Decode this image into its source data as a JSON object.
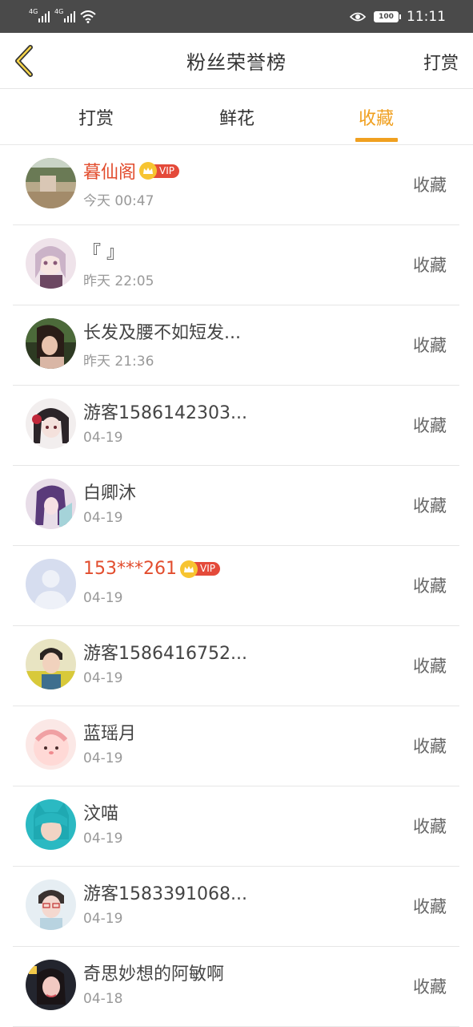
{
  "status_bar": {
    "signal1": "4G",
    "signal2": "4G",
    "battery": "100",
    "time": "11:11"
  },
  "nav": {
    "title": "粉丝荣誉榜",
    "action": "打赏"
  },
  "tabs": [
    {
      "label": "打赏"
    },
    {
      "label": "鲜花"
    },
    {
      "label": "收藏"
    }
  ],
  "active_tab": "收藏",
  "accent_color": "#f0a020",
  "vip_color": "#e24d2e",
  "vip_label": "VIP",
  "rows": [
    {
      "name": "暮仙阁",
      "vip": true,
      "time": "今天 00:47",
      "action": "收藏"
    },
    {
      "name": "『 』",
      "vip": false,
      "time": "昨天 22:05",
      "action": "收藏"
    },
    {
      "name": "长发及腰不如短发...",
      "vip": false,
      "time": "昨天 21:36",
      "action": "收藏"
    },
    {
      "name": "游客1586142303...",
      "vip": false,
      "time": "04-19",
      "action": "收藏"
    },
    {
      "name": "白卿沐",
      "vip": false,
      "time": "04-19",
      "action": "收藏"
    },
    {
      "name": "153***261",
      "vip": true,
      "time": "04-19",
      "action": "收藏"
    },
    {
      "name": "游客1586416752...",
      "vip": false,
      "time": "04-19",
      "action": "收藏"
    },
    {
      "name": "蓝瑶月",
      "vip": false,
      "time": "04-19",
      "action": "收藏"
    },
    {
      "name": "汶喵",
      "vip": false,
      "time": "04-19",
      "action": "收藏"
    },
    {
      "name": "游客1583391068...",
      "vip": false,
      "time": "04-19",
      "action": "收藏"
    },
    {
      "name": "奇思妙想的阿敏啊",
      "vip": false,
      "time": "04-18",
      "action": "收藏"
    }
  ]
}
